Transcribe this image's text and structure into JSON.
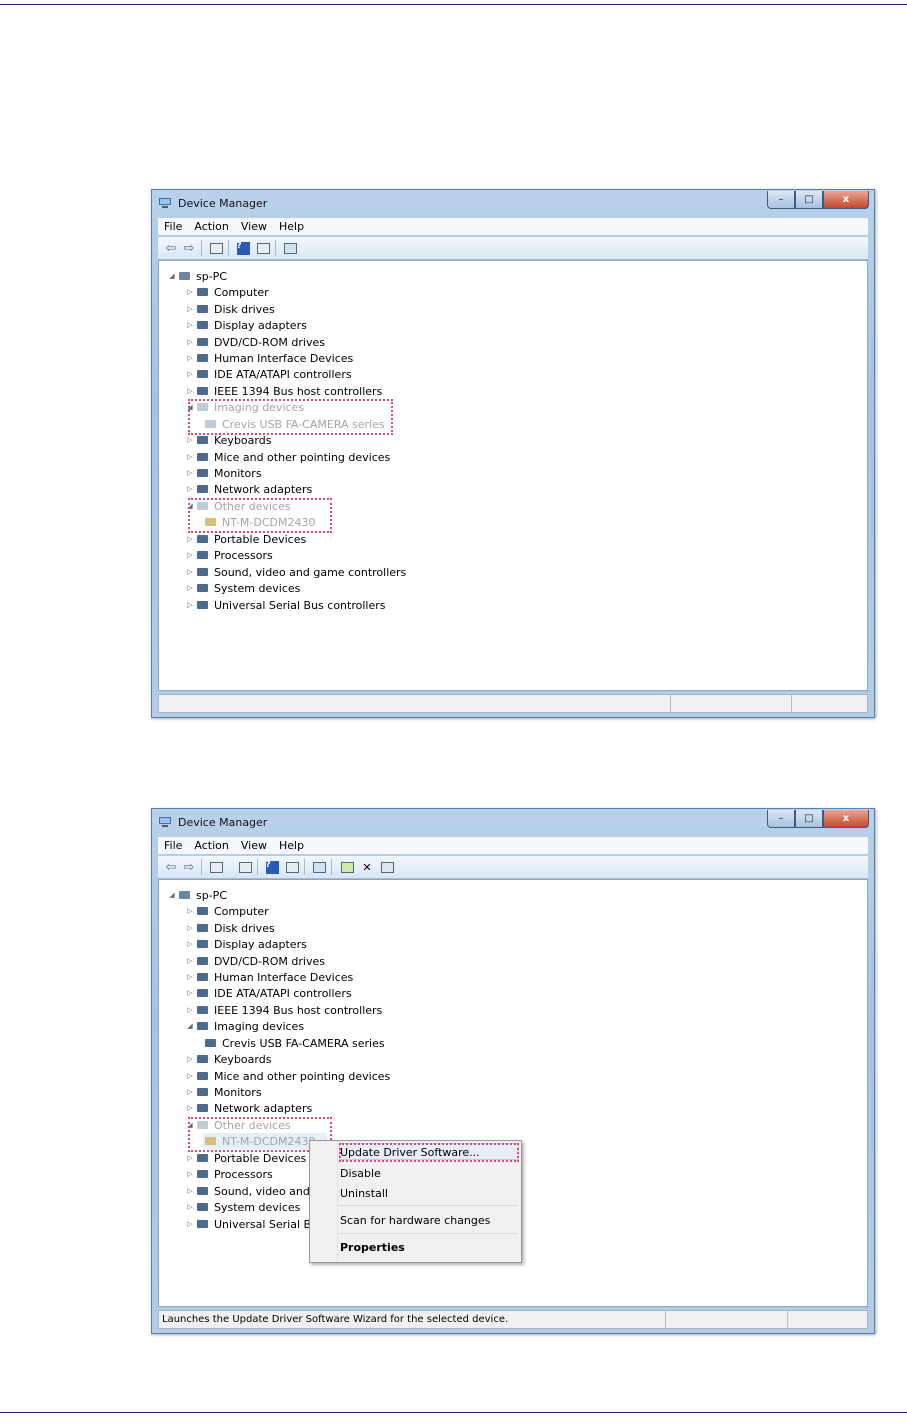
{
  "window_title": "Device Manager",
  "menu": [
    "File",
    "Action",
    "View",
    "Help"
  ],
  "root_label": "sp-PC",
  "categories": {
    "computer": "Computer",
    "disk_drives": "Disk drives",
    "display_adapters": "Display adapters",
    "dvd": "DVD/CD-ROM drives",
    "hid": "Human Interface Devices",
    "ide": "IDE ATA/ATAPI controllers",
    "ieee": "IEEE 1394 Bus host controllers",
    "imaging": "Imaging devices",
    "imaging_child": "Crevis USB FA-CAMERA series",
    "keyboards": "Keyboards",
    "mice": "Mice and other pointing devices",
    "monitors": "Monitors",
    "network": "Network adapters",
    "other": "Other devices",
    "other_child": "NT-M-DCDM2430",
    "portable": "Portable Devices",
    "processors": "Processors",
    "sound": "Sound, video and game controllers",
    "sound_short": "Sound, video and g",
    "system": "System devices",
    "usb": "Universal Serial Bus controllers",
    "usb_short": "Universal Serial Bus"
  },
  "context_menu": {
    "update": "Update Driver Software...",
    "disable": "Disable",
    "uninstall": "Uninstall",
    "scan": "Scan for hardware changes",
    "properties": "Properties"
  },
  "status_text_2": "Launches the Update Driver Software Wizard for the selected device.",
  "window_controls": {
    "minimize": "–",
    "maximize": "□",
    "close": "x"
  },
  "toolbar_1": [
    "arrow-back-icon",
    "arrow-forward-icon",
    "properties-icon",
    "help-icon",
    "view-icon",
    "scan-icon"
  ],
  "toolbar_2": [
    "arrow-back-icon",
    "arrow-forward-icon",
    "properties-icon",
    "view-list-icon",
    "help-icon",
    "view-icon",
    "scan-icon",
    "update-driver-icon",
    "uninstall-icon",
    "disable-icon"
  ],
  "colors": {
    "accent": "#e0457a",
    "title_bar": "#b9d1ea"
  }
}
